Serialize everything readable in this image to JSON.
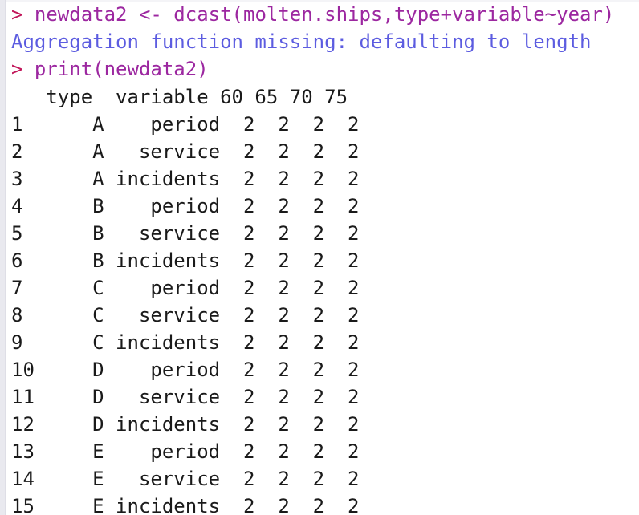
{
  "console": {
    "app": "R console",
    "prompt_symbol": ">",
    "colors": {
      "prompt": "#c2185b",
      "command": "#9c27a0",
      "message": "#5c5ce0",
      "output": "#1a1a1a",
      "background": "#ffffff",
      "gutter": "#e9e9ef"
    },
    "lines": [
      {
        "kind": "command",
        "prompt": "> ",
        "text": "newdata2 <- dcast(molten.ships,type+variable~year)"
      },
      {
        "kind": "message",
        "prompt": "",
        "text": "Aggregation function missing: defaulting to length"
      },
      {
        "kind": "command",
        "prompt": "> ",
        "text": "print(newdata2)"
      }
    ]
  },
  "table": {
    "row_number_header": "",
    "columns": [
      "type",
      "variable",
      "60",
      "65",
      "70",
      "75"
    ],
    "header_line": "   type  variable 60 65 70 75",
    "rows": [
      {
        "n": "1",
        "type": "A",
        "variable": "period",
        "v60": "2",
        "v65": "2",
        "v70": "2",
        "v75": "2",
        "line": "1      A    period  2  2  2  2"
      },
      {
        "n": "2",
        "type": "A",
        "variable": "service",
        "v60": "2",
        "v65": "2",
        "v70": "2",
        "v75": "2",
        "line": "2      A   service  2  2  2  2"
      },
      {
        "n": "3",
        "type": "A",
        "variable": "incidents",
        "v60": "2",
        "v65": "2",
        "v70": "2",
        "v75": "2",
        "line": "3      A incidents  2  2  2  2"
      },
      {
        "n": "4",
        "type": "B",
        "variable": "period",
        "v60": "2",
        "v65": "2",
        "v70": "2",
        "v75": "2",
        "line": "4      B    period  2  2  2  2"
      },
      {
        "n": "5",
        "type": "B",
        "variable": "service",
        "v60": "2",
        "v65": "2",
        "v70": "2",
        "v75": "2",
        "line": "5      B   service  2  2  2  2"
      },
      {
        "n": "6",
        "type": "B",
        "variable": "incidents",
        "v60": "2",
        "v65": "2",
        "v70": "2",
        "v75": "2",
        "line": "6      B incidents  2  2  2  2"
      },
      {
        "n": "7",
        "type": "C",
        "variable": "period",
        "v60": "2",
        "v65": "2",
        "v70": "2",
        "v75": "2",
        "line": "7      C    period  2  2  2  2"
      },
      {
        "n": "8",
        "type": "C",
        "variable": "service",
        "v60": "2",
        "v65": "2",
        "v70": "2",
        "v75": "2",
        "line": "8      C   service  2  2  2  2"
      },
      {
        "n": "9",
        "type": "C",
        "variable": "incidents",
        "v60": "2",
        "v65": "2",
        "v70": "2",
        "v75": "2",
        "line": "9      C incidents  2  2  2  2"
      },
      {
        "n": "10",
        "type": "D",
        "variable": "period",
        "v60": "2",
        "v65": "2",
        "v70": "2",
        "v75": "2",
        "line": "10     D    period  2  2  2  2"
      },
      {
        "n": "11",
        "type": "D",
        "variable": "service",
        "v60": "2",
        "v65": "2",
        "v70": "2",
        "v75": "2",
        "line": "11     D   service  2  2  2  2"
      },
      {
        "n": "12",
        "type": "D",
        "variable": "incidents",
        "v60": "2",
        "v65": "2",
        "v70": "2",
        "v75": "2",
        "line": "12     D incidents  2  2  2  2"
      },
      {
        "n": "13",
        "type": "E",
        "variable": "period",
        "v60": "2",
        "v65": "2",
        "v70": "2",
        "v75": "2",
        "line": "13     E    period  2  2  2  2"
      },
      {
        "n": "14",
        "type": "E",
        "variable": "service",
        "v60": "2",
        "v65": "2",
        "v70": "2",
        "v75": "2",
        "line": "14     E   service  2  2  2  2"
      },
      {
        "n": "15",
        "type": "E",
        "variable": "incidents",
        "v60": "2",
        "v65": "2",
        "v70": "2",
        "v75": "2",
        "line": "15     E incidents  2  2  2  2"
      }
    ]
  }
}
